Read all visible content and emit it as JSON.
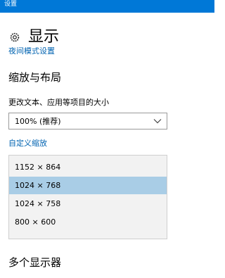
{
  "window": {
    "title": "设置"
  },
  "page": {
    "title": "显示",
    "cut_off_link": "夜间模式设置"
  },
  "scale_section": {
    "heading": "缩放与布局",
    "size_label": "更改文本、应用等项目的大小",
    "size_value": "100% (推荐)",
    "custom_link": "自定义缩放"
  },
  "resolution_options": [
    {
      "label": "1152 × 864",
      "selected": false
    },
    {
      "label": "1024 × 768",
      "selected": true
    },
    {
      "label": "1024 × 758",
      "selected": false
    },
    {
      "label": "800 × 600",
      "selected": false
    }
  ],
  "multi_section": {
    "heading": "多个显示器"
  },
  "colors": {
    "accent": "#0078d7",
    "link": "#0063b1",
    "selection": "#a9cde6",
    "dropdown_bg": "#f2f2f2"
  },
  "icons": {
    "page_icon": "gear-icon",
    "dropdown_icon": "chevron-down-icon"
  }
}
